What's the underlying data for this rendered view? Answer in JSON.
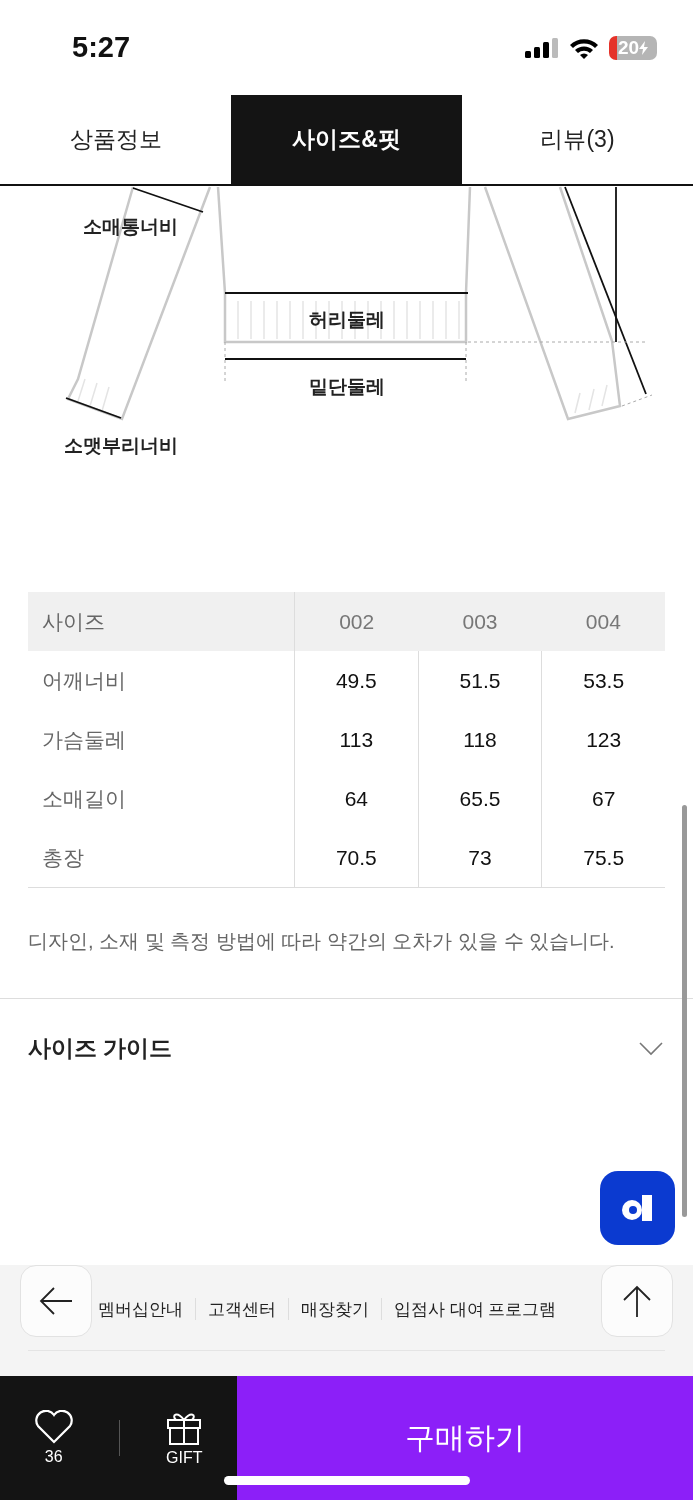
{
  "status_bar": {
    "time": "5:27",
    "battery": "20"
  },
  "tabs": [
    {
      "label": "상품정보",
      "selected": false
    },
    {
      "label": "사이즈&핏",
      "selected": true
    },
    {
      "label": "리뷰(3)",
      "selected": false
    }
  ],
  "diagram": {
    "sleeve_width": "소매통너비",
    "waist": "허리둘레",
    "hem": "밑단둘레",
    "cuff": "소맷부리너비"
  },
  "size_table": {
    "columns": [
      "사이즈",
      "002",
      "003",
      "004"
    ],
    "rows": [
      {
        "label": "어깨너비",
        "values": [
          "49.5",
          "51.5",
          "53.5"
        ]
      },
      {
        "label": "가슴둘레",
        "values": [
          "113",
          "118",
          "123"
        ]
      },
      {
        "label": "소매길이",
        "values": [
          "64",
          "65.5",
          "67"
        ]
      },
      {
        "label": "총장",
        "values": [
          "70.5",
          "73",
          "75.5"
        ]
      }
    ]
  },
  "note": "디자인, 소재 및 측정 방법에 따라 약간의 오차가 있을 수 있습니다.",
  "size_guide": {
    "title": "사이즈 가이드",
    "expanded": false
  },
  "footer_links": [
    "멤버십안내",
    "고객센터",
    "매장찾기",
    "입점사 대여 프로그램"
  ],
  "bottom_bar": {
    "likes": "36",
    "gift": "GIFT",
    "buy": "구매하기"
  }
}
